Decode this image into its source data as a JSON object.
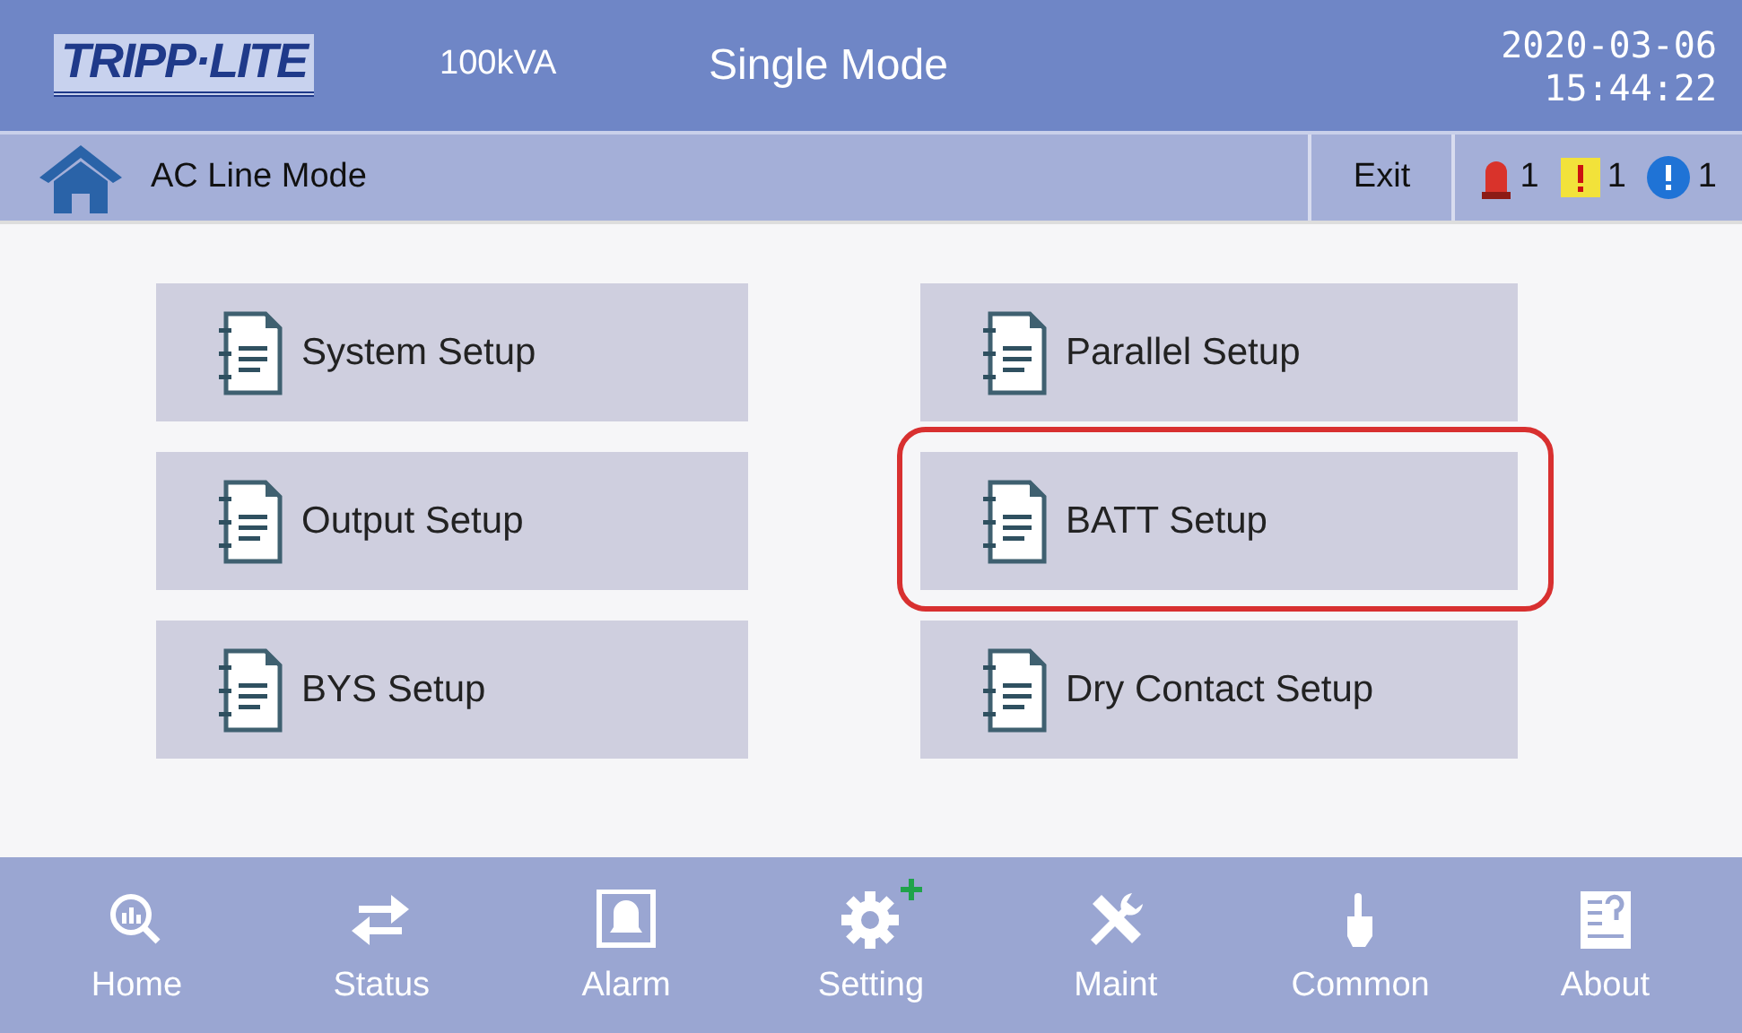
{
  "header": {
    "logo": "TRIPP·LITE",
    "capacity": "100kVA",
    "mode": "Single Mode",
    "date": "2020-03-06",
    "time": "15:44:22"
  },
  "subheader": {
    "status": "AC Line Mode",
    "exit": "Exit",
    "alarms": [
      {
        "kind": "critical",
        "count": "1"
      },
      {
        "kind": "warning",
        "count": "1"
      },
      {
        "kind": "info",
        "count": "1"
      }
    ]
  },
  "menu": [
    {
      "label": "System Setup",
      "highlighted": false
    },
    {
      "label": "Parallel Setup",
      "highlighted": false
    },
    {
      "label": "Output Setup",
      "highlighted": false
    },
    {
      "label": "BATT Setup",
      "highlighted": true
    },
    {
      "label": "BYS Setup",
      "highlighted": false
    },
    {
      "label": "Dry Contact Setup",
      "highlighted": false
    }
  ],
  "nav": [
    {
      "kind": "home",
      "label": "Home",
      "selected": false
    },
    {
      "kind": "status",
      "label": "Status",
      "selected": false
    },
    {
      "kind": "alarm",
      "label": "Alarm",
      "selected": false
    },
    {
      "kind": "setting",
      "label": "Setting",
      "selected": true
    },
    {
      "kind": "maint",
      "label": "Maint",
      "selected": false
    },
    {
      "kind": "common",
      "label": "Common",
      "selected": false
    },
    {
      "kind": "about",
      "label": "About",
      "selected": false
    }
  ]
}
